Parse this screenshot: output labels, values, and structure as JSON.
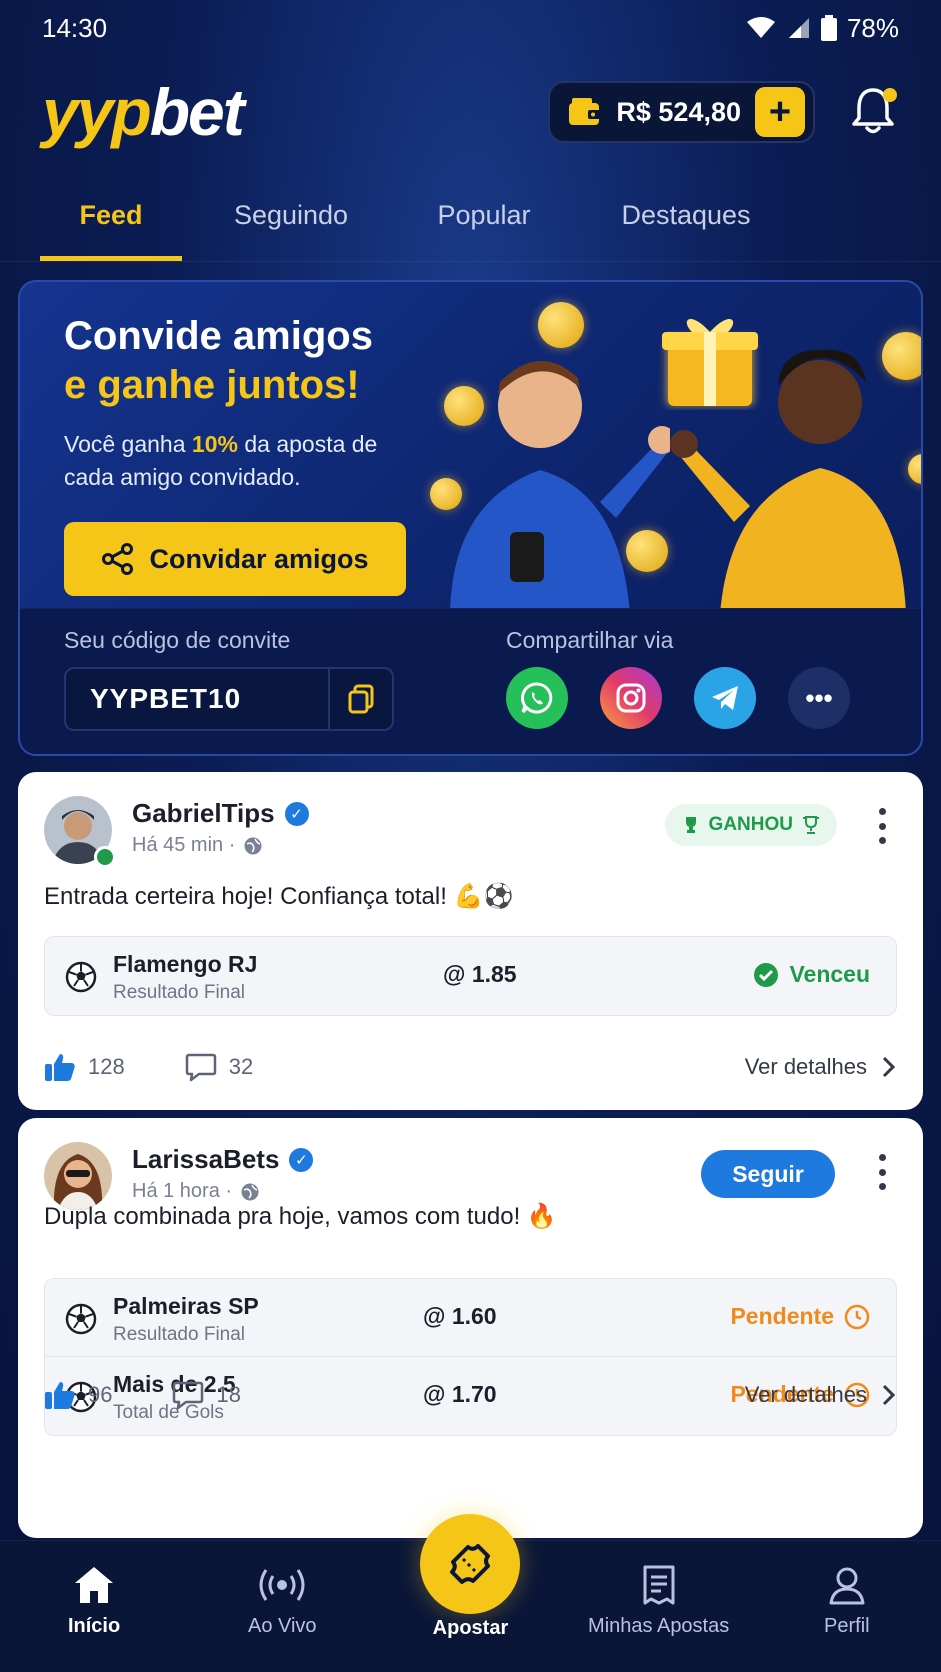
{
  "status_bar": {
    "time": "14:30",
    "battery": "78%"
  },
  "header": {
    "logo_part1": "yyp",
    "logo_part2": "bet",
    "balance": "R$ 524,80",
    "add_label": "+"
  },
  "tabs": [
    {
      "label": "Feed",
      "active": true
    },
    {
      "label": "Seguindo",
      "active": false
    },
    {
      "label": "Popular",
      "active": false
    },
    {
      "label": "Destaques",
      "active": false
    }
  ],
  "promo": {
    "title_line1": "Convide amigos",
    "title_line2": "e ganhe juntos!",
    "sub_before": "Você ganha ",
    "sub_pct": "10%",
    "sub_after": " da aposta de cada amigo convidado.",
    "button_label": "Convidar amigos",
    "code_label": "Seu código de convite",
    "code": "YYPBET10",
    "share_label": "Compartilhar via",
    "share_more": "•••"
  },
  "posts": [
    {
      "author": "GabrielTips",
      "time": "Há 45 min ·",
      "badge": "GANHOU",
      "text": "Entrada certeira hoje! Confiança total! 💪⚽",
      "bets": [
        {
          "team": "Flamengo RJ",
          "market": "Resultado Final",
          "odd": "@ 1.85",
          "status": "Venceu"
        }
      ],
      "likes": "128",
      "comments": "32",
      "details": "Ver detalhes"
    },
    {
      "author": "LarissaBets",
      "time": "Há 1 hora ·",
      "follow": "Seguir",
      "text": "Dupla combinada pra hoje, vamos com tudo! 🔥",
      "bets": [
        {
          "team": "Palmeiras SP",
          "market": "Resultado Final",
          "odd": "@ 1.60",
          "status": "Pendente"
        },
        {
          "team": "Mais de 2.5",
          "market": "Total de Gols",
          "odd": "@ 1.70",
          "status": "Pendente"
        }
      ],
      "likes": "96",
      "comments": "18",
      "details": "Ver detalhes"
    }
  ],
  "bottom_nav": [
    {
      "label": "Início",
      "icon": "home-icon",
      "active": true
    },
    {
      "label": "Ao Vivo",
      "icon": "live-icon",
      "active": false
    },
    {
      "label": "Apostar",
      "icon": "ticket-icon",
      "active": false
    },
    {
      "label": "Minhas Apostas",
      "icon": "receipt-icon",
      "active": false
    },
    {
      "label": "Perfil",
      "icon": "user-icon",
      "active": false
    }
  ],
  "colors": {
    "accent": "#f5c518",
    "bg": "#0b1d55",
    "win": "#1f9a4a",
    "pending": "#f28a1a",
    "follow": "#1f7ae0"
  }
}
